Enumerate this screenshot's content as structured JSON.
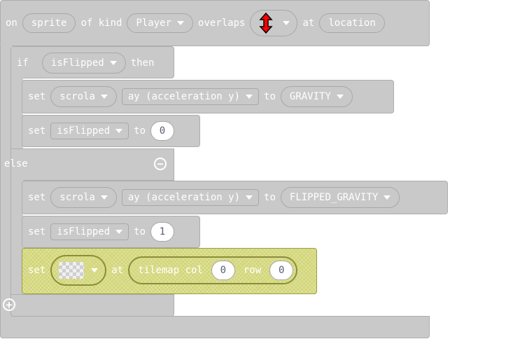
{
  "event": {
    "on": "on",
    "sprite": "sprite",
    "of_kind": "of kind",
    "kind": "Player",
    "overlaps": "overlaps",
    "tile_icon": "red-double-arrow-icon",
    "at": "at",
    "location": "location"
  },
  "if_block": {
    "if": "if",
    "condition": "isFlipped",
    "then": "then",
    "else": "else",
    "minus_icon": "minus-circle-icon",
    "plus_icon": "plus-circle-icon"
  },
  "stmt1": {
    "set": "set",
    "target": "scrola",
    "property": "ay (acceleration y)",
    "to": "to",
    "value": "GRAVITY"
  },
  "stmt2": {
    "set": "set",
    "variable": "isFlipped",
    "to": "to",
    "value": "0"
  },
  "stmt3": {
    "set": "set",
    "target": "scrola",
    "property": "ay (acceleration y)",
    "to": "to",
    "value": "FLIPPED_GRAVITY"
  },
  "stmt4": {
    "set": "set",
    "variable": "isFlipped",
    "to": "to",
    "value": "1"
  },
  "stmt5": {
    "set": "set",
    "tile_image": "transparent-tile",
    "at": "at",
    "tilemap_col": "tilemap col",
    "col": "0",
    "row_label": "row",
    "row": "0"
  },
  "colors": {
    "block": "#c9c9c9",
    "border": "#aeaeae",
    "tile_block": "#d2d576",
    "icon": "#ff0000"
  }
}
